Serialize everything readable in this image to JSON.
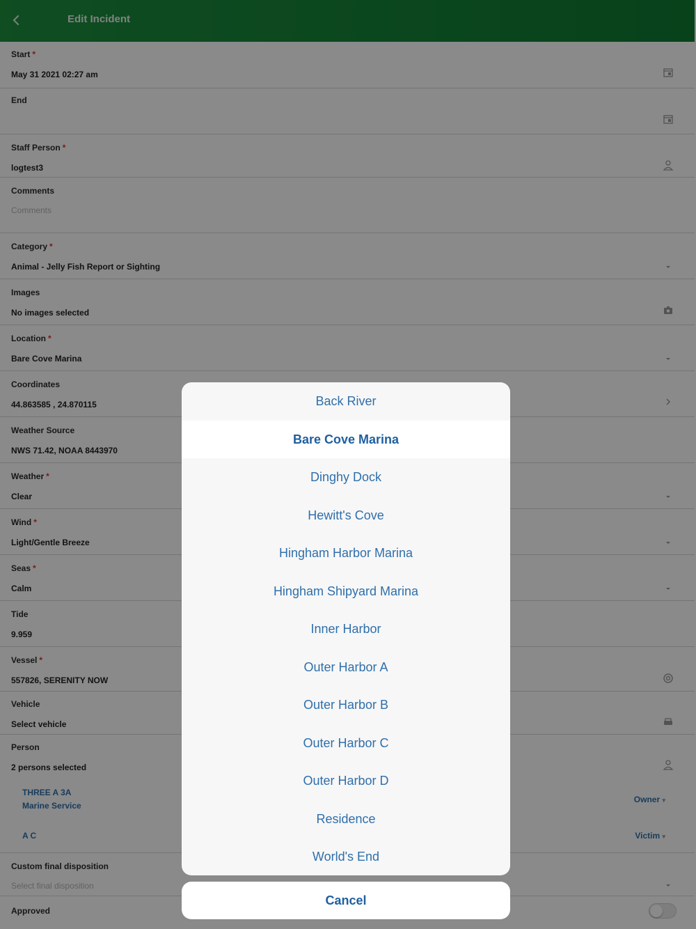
{
  "header": {
    "title": "Edit Incident"
  },
  "fields": {
    "start": {
      "label": "Start",
      "value": "May 31 2021 02:27 am"
    },
    "end": {
      "label": "End",
      "value": ""
    },
    "staff": {
      "label": "Staff Person",
      "value": "logtest3"
    },
    "comments": {
      "label": "Comments",
      "placeholder": "Comments"
    },
    "category": {
      "label": "Category",
      "value": "Animal - Jelly Fish Report or Sighting"
    },
    "images": {
      "label": "Images",
      "value": "No images selected"
    },
    "location": {
      "label": "Location",
      "value": "Bare Cove Marina"
    },
    "coordinates": {
      "label": "Coordinates",
      "value": "44.863585 , 24.870115"
    },
    "weather_source": {
      "label": "Weather Source",
      "value": "NWS 71.42, NOAA 8443970"
    },
    "weather": {
      "label": "Weather",
      "value": "Clear"
    },
    "wind": {
      "label": "Wind",
      "value": "Light/Gentle Breeze"
    },
    "seas": {
      "label": "Seas",
      "value": "Calm"
    },
    "tide": {
      "label": "Tide",
      "value": "9.959"
    },
    "vessel": {
      "label": "Vessel",
      "value": "557826, SERENITY NOW"
    },
    "vehicle": {
      "label": "Vehicle",
      "value": "Select vehicle"
    },
    "person": {
      "label": "Person",
      "value": "2 persons selected"
    },
    "disposition": {
      "label": "Custom final disposition",
      "placeholder": "Select final disposition"
    },
    "approved": {
      "label": "Approved",
      "checked": false
    }
  },
  "persons": [
    {
      "line1": "THREE A 3A",
      "line2": "Marine Service",
      "role": "Owner"
    },
    {
      "line1": "A C",
      "line2": "",
      "role": "Victim"
    }
  ],
  "picker": {
    "options": [
      "Back River",
      "Bare Cove Marina",
      "Dinghy Dock",
      "Hewitt's Cove",
      "Hingham Harbor Marina",
      "Hingham Shipyard Marina",
      "Inner Harbor",
      "Outer Harbor A",
      "Outer Harbor B",
      "Outer Harbor C",
      "Outer Harbor D",
      "Residence",
      "World's End"
    ],
    "selected": "Bare Cove Marina",
    "cancel": "Cancel"
  },
  "colors": {
    "header": "#1e8e3e",
    "accent": "#2f6fab",
    "required": "#dd3333"
  }
}
